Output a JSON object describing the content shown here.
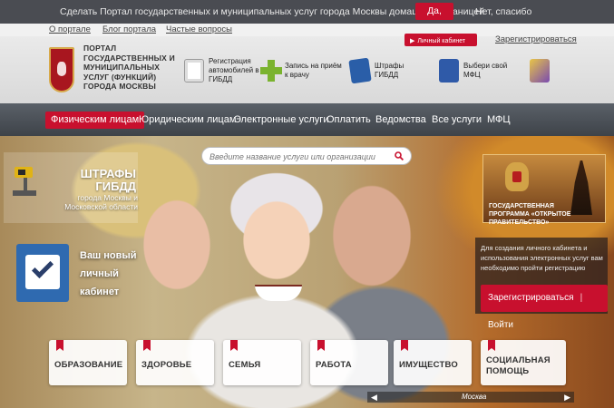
{
  "topbar": {
    "message": "Сделать Портал государственных и муниципальных услуг города Москвы домашней страницей",
    "yes_label": "Да, конечно",
    "no_label": "Нет, спасибо"
  },
  "util_links": [
    "О портале",
    "Блог портала",
    "Частые вопросы"
  ],
  "header": {
    "portal_title": "ПОРТАЛ ГОСУДАРСТВЕННЫХ И МУНИЦИПАЛЬНЫХ УСЛУГ (ФУНКЦИЙ) ГОРОДА МОСКВЫ",
    "personal_cabinet": "Личный кабинет",
    "register": "Зарегистрироваться",
    "quick_links": [
      {
        "label": "Регистрация автомобилей в ГИБДД",
        "icon": "car-registration-icon"
      },
      {
        "label": "Запись на приём к врачу",
        "icon": "medical-cross-icon"
      },
      {
        "label": "Штрафы ГИБДД",
        "icon": "fines-icon"
      },
      {
        "label": "Выбери свой МФЦ",
        "icon": "mfc-icon"
      },
      {
        "label": "",
        "icon": "sport-icon"
      }
    ]
  },
  "nav": [
    "Физическим лицам",
    "Юридическим лицам",
    "Электронные услуги",
    "Оплатить",
    "Ведомства",
    "Все услуги",
    "МФЦ"
  ],
  "search": {
    "placeholder": "Введите название услуги или организации"
  },
  "promo_fines": {
    "title": "ШТРАФЫ ГИБДД",
    "subtitle": "города Москвы и Московской области"
  },
  "promo_cabinet": {
    "text": "Ваш новый личный кабинет"
  },
  "gov_program": {
    "text": "ГОСУДАРСТВЕННАЯ ПРОГРАММА «ОТКРЫТОЕ ПРАВИТЕЛЬСТВО»"
  },
  "register_box": {
    "note": "Для создания личного кабинета и использования электронных услуг вам необходимо пройти регистрацию",
    "register": "Зарегистрироваться",
    "login": "Войти"
  },
  "categories": [
    "ОБРАЗОВАНИЕ",
    "ЗДОРОВЬЕ",
    "СЕМЬЯ",
    "РАБОТА",
    "ИМУЩЕСТВО",
    "СОЦИАЛЬНАЯ ПОМОЩЬ"
  ],
  "slider": {
    "city": "Москва"
  },
  "colors": {
    "accent": "#c8102e",
    "nav": "#4a4f56",
    "topbar": "#4a4c52"
  }
}
